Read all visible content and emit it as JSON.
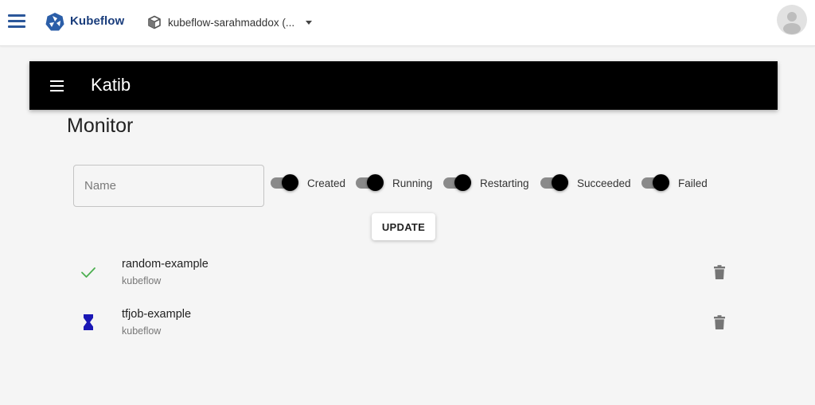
{
  "topbar": {
    "brand": "Kubeflow",
    "namespace": "kubeflow-sarahmaddox (..."
  },
  "katib": {
    "title": "Katib"
  },
  "monitor": {
    "title": "Monitor",
    "name_placeholder": "Name",
    "filters": [
      {
        "label": "Created",
        "on": true
      },
      {
        "label": "Running",
        "on": true
      },
      {
        "label": "Restarting",
        "on": true
      },
      {
        "label": "Succeeded",
        "on": true
      },
      {
        "label": "Failed",
        "on": true
      }
    ],
    "update_label": "UPDATE"
  },
  "jobs": [
    {
      "name": "random-example",
      "namespace": "kubeflow",
      "status_icon": "check-icon",
      "status_color": "#4caf50"
    },
    {
      "name": "tfjob-example",
      "namespace": "kubeflow",
      "status_icon": "hourglass-icon",
      "status_color": "#1a17b5"
    }
  ],
  "colors": {
    "brand_blue": "#1a3d7c",
    "header_bg": "#000000",
    "icon_grey": "#757575"
  }
}
